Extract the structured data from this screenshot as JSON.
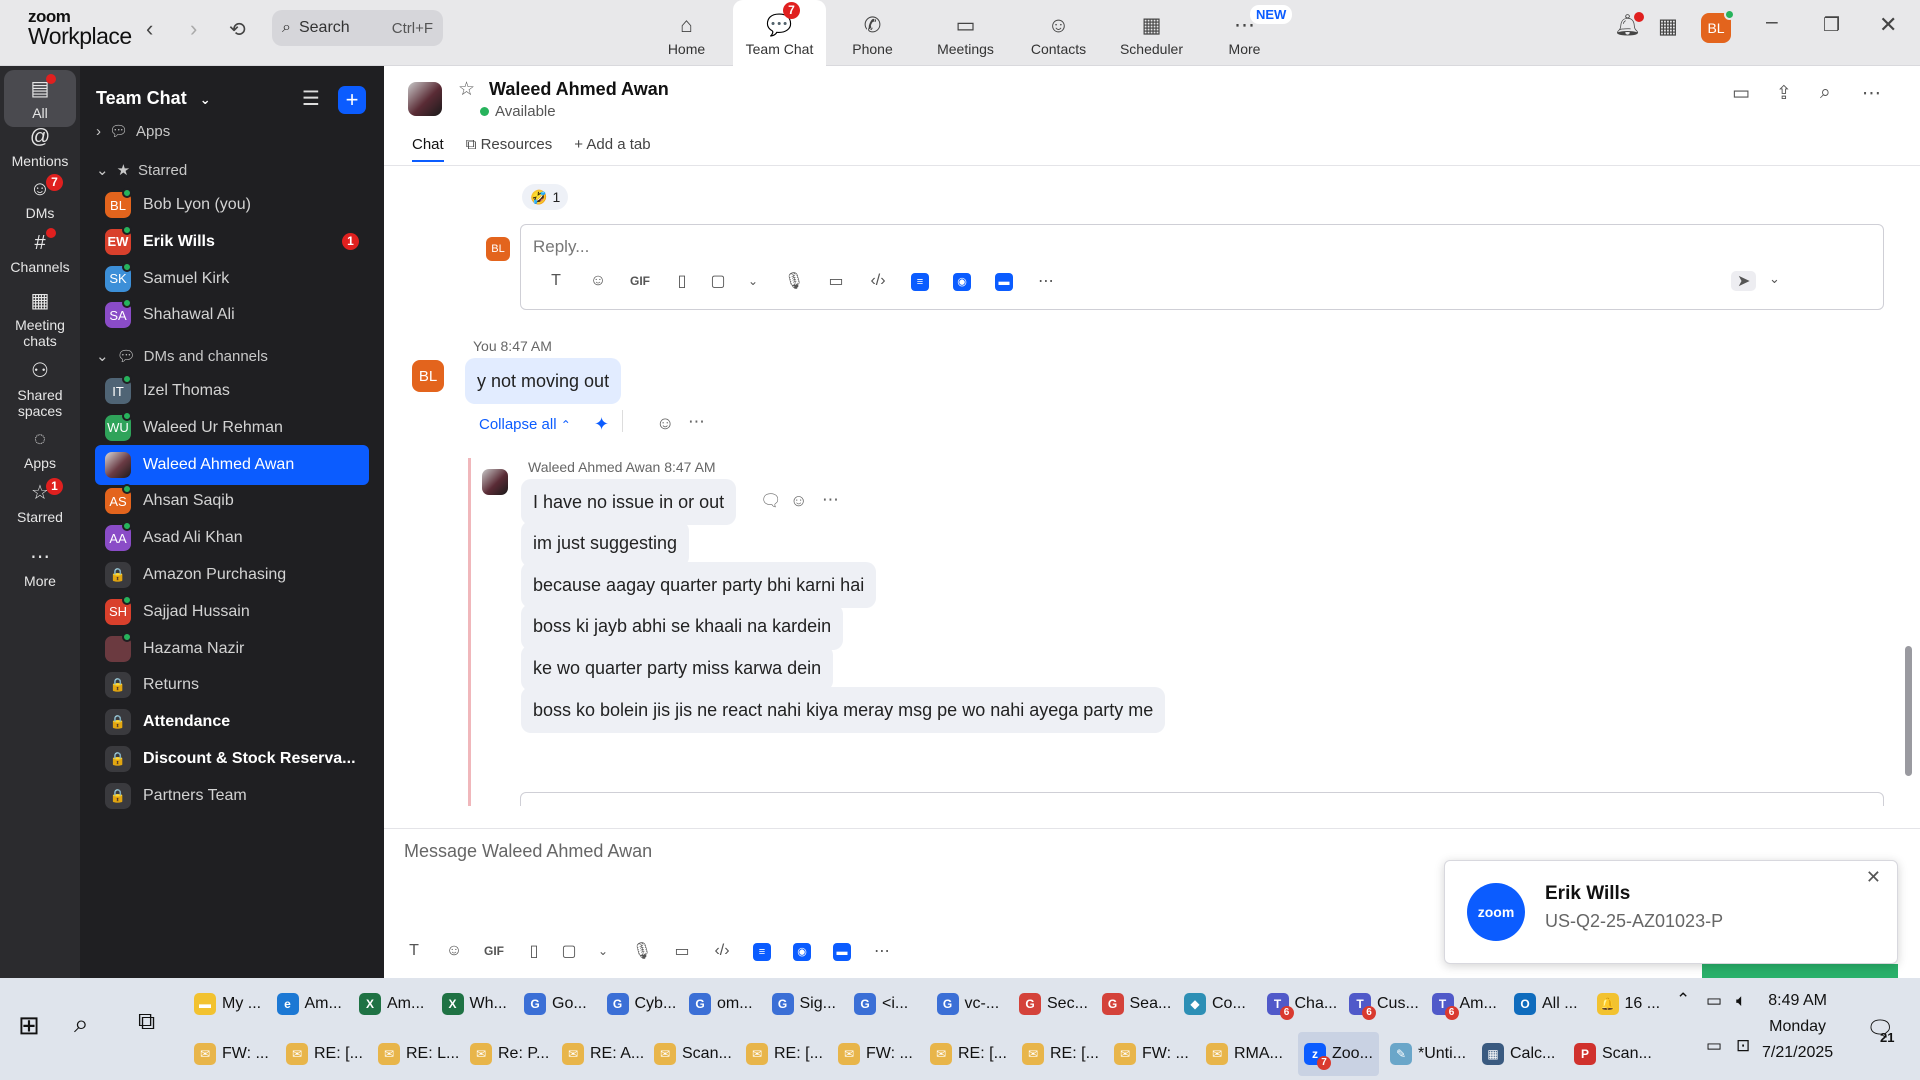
{
  "app": {
    "logo_line1": "zoom",
    "logo_line2": "Workplace"
  },
  "search": {
    "placeholder": "Search",
    "shortcut": "Ctrl+F"
  },
  "tabs": [
    {
      "label": "Home",
      "icon": "home-icon",
      "glyph": "⌂"
    },
    {
      "label": "Team Chat",
      "icon": "chat-icon",
      "glyph": "💬",
      "badge": "7",
      "active": true
    },
    {
      "label": "Phone",
      "icon": "phone-icon",
      "glyph": "✆"
    },
    {
      "label": "Meetings",
      "icon": "video-icon",
      "glyph": "▭"
    },
    {
      "label": "Contacts",
      "icon": "contacts-icon",
      "glyph": "☺"
    },
    {
      "label": "Scheduler",
      "icon": "calendar-icon",
      "glyph": "▦"
    },
    {
      "label": "More",
      "icon": "more-icon",
      "glyph": "⋯",
      "new_badge": "NEW"
    }
  ],
  "user": {
    "initials": "BL"
  },
  "rail": [
    {
      "label": "All",
      "glyph": "▤",
      "active": true
    },
    {
      "label": "Mentions",
      "glyph": "@"
    },
    {
      "label": "DMs",
      "glyph": "☺",
      "badge": "7"
    },
    {
      "label": "Channels",
      "glyph": "#"
    },
    {
      "label": "Meeting chats",
      "glyph": "▦"
    },
    {
      "label": "Shared spaces",
      "glyph": "⚇"
    },
    {
      "label": "Apps",
      "glyph": "◌"
    },
    {
      "label": "Starred",
      "glyph": "☆",
      "badge": "1"
    },
    {
      "label": "More",
      "glyph": "⋯"
    }
  ],
  "sidebar": {
    "title": "Team Chat",
    "apps_label": "Apps",
    "starred_label": "Starred",
    "dms_label": "DMs and channels",
    "starred": [
      {
        "name": "Bob Lyon (you)",
        "initials": "BL",
        "color": "#e3641d",
        "online": true
      },
      {
        "name": "Erik Wills",
        "initials": "EW",
        "color": "#d9402c",
        "online": true,
        "bold": true,
        "badge": "1"
      },
      {
        "name": "Samuel Kirk",
        "initials": "SK",
        "color": "#3c8fd8",
        "online": true
      },
      {
        "name": "Shahawal Ali",
        "initials": "SA",
        "color": "#8a4cc7",
        "online": true
      }
    ],
    "dms": [
      {
        "name": "Izel Thomas",
        "initials": "IT",
        "color": "#4f6475",
        "online": true
      },
      {
        "name": "Waleed Ur Rehman",
        "initials": "WU",
        "color": "#2fa35a",
        "online": true
      },
      {
        "name": "Waleed Ahmed Awan",
        "initials": "",
        "color": "#6a3b44",
        "selected": true
      },
      {
        "name": "Ahsan Saqib",
        "initials": "AS",
        "color": "#e3641d",
        "online": true
      },
      {
        "name": "Asad Ali Khan",
        "initials": "AA",
        "color": "#8a4cc7",
        "online": true
      },
      {
        "name": "Amazon Purchasing",
        "initials": "🔒",
        "color": "#3a3a3e"
      },
      {
        "name": "Sajjad Hussain",
        "initials": "SH",
        "color": "#d9402c",
        "online": true
      },
      {
        "name": "Hazama Nazir",
        "initials": "",
        "color": "#6b3a40",
        "online": true
      },
      {
        "name": "Returns",
        "initials": "🔒",
        "color": "#3a3a3e"
      },
      {
        "name": "Attendance",
        "initials": "🔒",
        "color": "#3a3a3e",
        "bold": true
      },
      {
        "name": "Discount & Stock Reserva...",
        "initials": "🔒",
        "color": "#3a3a3e",
        "bold": true
      },
      {
        "name": "Partners Team",
        "initials": "🔒",
        "color": "#3a3a3e"
      }
    ]
  },
  "chat": {
    "name": "Waleed Ahmed Awan",
    "status": "Available",
    "tab_chat": "Chat",
    "tab_resources": "Resources",
    "tab_add": "Add a tab",
    "reaction_emoji": "🤣",
    "reaction_count": "1",
    "reply_placeholder": "Reply...",
    "my_sender": "You",
    "my_time": "8:47 AM",
    "my_initials": "BL",
    "my_message": "y not moving out",
    "collapse_label": "Collapse all",
    "thread_sender": "Waleed Ahmed Awan",
    "thread_time": "8:47 AM",
    "thread_messages": [
      "I have no issue in or out",
      "im just suggesting",
      "because aagay quarter party bhi karni hai",
      "boss ki jayb abhi se khaali na kardein",
      "ke wo quarter party miss karwa dein",
      "boss ko bolein jis jis ne react nahi kiya meray msg pe wo nahi ayega party me"
    ],
    "compose_placeholder": "Message Waleed Ahmed Awan",
    "format_gif": "GIF"
  },
  "toast": {
    "logo": "zoom",
    "title": "Erik Wills",
    "subtitle": "US-Q2-25-AZ01023-P"
  },
  "taskbar": {
    "row1": [
      {
        "label": "My ...",
        "color": "#f2c230",
        "glyph": "▬"
      },
      {
        "label": "Am...",
        "color": "#1c78d4",
        "glyph": "e"
      },
      {
        "label": "Am...",
        "color": "#1f7244",
        "glyph": "X"
      },
      {
        "label": "Wh...",
        "color": "#1f7244",
        "glyph": "X"
      },
      {
        "label": "Go...",
        "color": "#3b6fd6",
        "glyph": "G"
      },
      {
        "label": "Cyb...",
        "color": "#3b6fd6",
        "glyph": "G"
      },
      {
        "label": "om...",
        "color": "#3b6fd6",
        "glyph": "G"
      },
      {
        "label": "Sig...",
        "color": "#3b6fd6",
        "glyph": "G"
      },
      {
        "label": "<i...",
        "color": "#3b6fd6",
        "glyph": "G"
      },
      {
        "label": "vc-...",
        "color": "#3b6fd6",
        "glyph": "G"
      },
      {
        "label": "Sec...",
        "color": "#d4423a",
        "glyph": "G"
      },
      {
        "label": "Sea...",
        "color": "#d4423a",
        "glyph": "G"
      },
      {
        "label": "Co...",
        "color": "#2d8fb5",
        "glyph": "◆"
      },
      {
        "label": "Cha...",
        "color": "#5059c9",
        "glyph": "T",
        "badge": "6"
      },
      {
        "label": "Cus...",
        "color": "#5059c9",
        "glyph": "T",
        "badge": "6"
      },
      {
        "label": "Am...",
        "color": "#5059c9",
        "glyph": "T",
        "badge": "6"
      },
      {
        "label": "All ...",
        "color": "#0f6cbd",
        "glyph": "O"
      },
      {
        "label": "16 ...",
        "color": "#f2c230",
        "glyph": "🔔"
      }
    ],
    "row2": [
      {
        "label": "FW: ...",
        "color": "#e8b54a",
        "glyph": "✉"
      },
      {
        "label": "RE: [...",
        "color": "#e8b54a",
        "glyph": "✉"
      },
      {
        "label": "RE: L...",
        "color": "#e8b54a",
        "glyph": "✉"
      },
      {
        "label": "Re: P...",
        "color": "#e8b54a",
        "glyph": "✉"
      },
      {
        "label": "RE: A...",
        "color": "#e8b54a",
        "glyph": "✉"
      },
      {
        "label": "Scan...",
        "color": "#e8b54a",
        "glyph": "✉"
      },
      {
        "label": "RE: [...",
        "color": "#e8b54a",
        "glyph": "✉"
      },
      {
        "label": "FW: ...",
        "color": "#e8b54a",
        "glyph": "✉"
      },
      {
        "label": "RE: [...",
        "color": "#e8b54a",
        "glyph": "✉"
      },
      {
        "label": "RE: [...",
        "color": "#e8b54a",
        "glyph": "✉"
      },
      {
        "label": "FW: ...",
        "color": "#e8b54a",
        "glyph": "✉"
      },
      {
        "label": "RMA...",
        "color": "#e8b54a",
        "glyph": "✉"
      },
      {
        "label": "Zoo...",
        "color": "#0b5cff",
        "glyph": "z",
        "badge": "7",
        "active": true
      },
      {
        "label": "*Unti...",
        "color": "#6aa6c9",
        "glyph": "✎"
      },
      {
        "label": "Calc...",
        "color": "#3a5a80",
        "glyph": "▦"
      },
      {
        "label": "Scan...",
        "color": "#d0312d",
        "glyph": "P"
      }
    ],
    "time": "8:49 AM",
    "day": "Monday",
    "date": "7/21/2025",
    "notif_count": "21"
  }
}
